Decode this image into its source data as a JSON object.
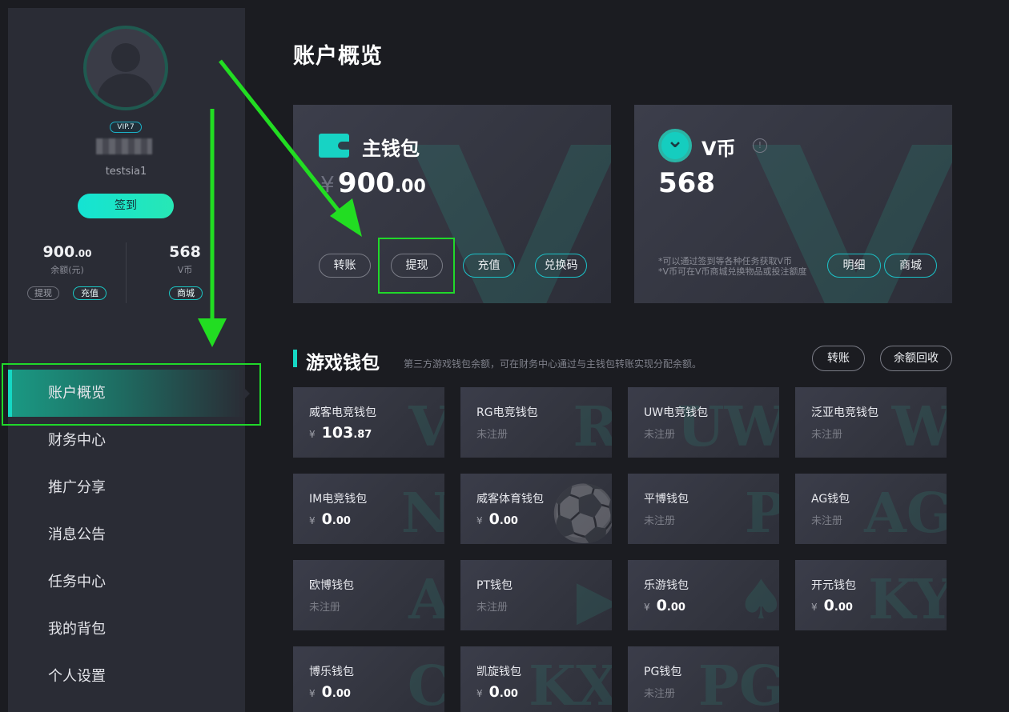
{
  "sidebar": {
    "vip_badge": "VIP.7",
    "username": "testsia1",
    "signin_label": "签到",
    "balance": {
      "int": "900",
      "dec": ".00",
      "label": "余额(元)"
    },
    "vcoin": {
      "value": "568",
      "label": "V币"
    },
    "withdraw_pill": "提现",
    "recharge_pill": "充值",
    "shop_pill": "商城",
    "nav": [
      "账户概览",
      "财务中心",
      "推广分享",
      "消息公告",
      "任务中心",
      "我的背包",
      "个人设置"
    ]
  },
  "main": {
    "title": "账户概览",
    "main_wallet": {
      "title": "主钱包",
      "currency": "¥",
      "amount_int": "900",
      "amount_dec": ".00",
      "buttons": [
        "转账",
        "提现",
        "充值",
        "兑换码"
      ]
    },
    "vcoin_card": {
      "title": "V币",
      "info": "!",
      "amount": "568",
      "note_1": "*可以通过签到等各种任务获取V币",
      "note_2": "*V币可在V币商城兑换物品或投注额度",
      "buttons": [
        "明细",
        "商城"
      ]
    },
    "game_section": {
      "title": "游戏钱包",
      "subtitle": "第三方游戏钱包余额，可在财务中心通过与主钱包转账实现分配余额。",
      "transfer_label": "转账",
      "recover_label": "余额回收"
    },
    "unregistered_label": "未注册",
    "currency": "¥",
    "games": [
      {
        "name": "威客电竞钱包",
        "int": "103",
        "dec": ".87",
        "deco": "V"
      },
      {
        "name": "RG电竞钱包",
        "registered": false,
        "deco": "R"
      },
      {
        "name": "UW电竞钱包",
        "registered": false,
        "deco": "UW"
      },
      {
        "name": "泛亚电竞钱包",
        "registered": false,
        "deco": "W"
      },
      {
        "name": "IM电竞钱包",
        "int": "0",
        "dec": ".00",
        "deco": "N"
      },
      {
        "name": "威客体育钱包",
        "int": "0",
        "dec": ".00",
        "deco": "⚽"
      },
      {
        "name": "平博钱包",
        "registered": false,
        "deco": "P"
      },
      {
        "name": "AG钱包",
        "registered": false,
        "deco": "AG"
      },
      {
        "name": "欧博钱包",
        "registered": false,
        "deco": "A"
      },
      {
        "name": "PT钱包",
        "registered": false,
        "deco": "▶"
      },
      {
        "name": "乐游钱包",
        "int": "0",
        "dec": ".00",
        "deco": "♠"
      },
      {
        "name": "开元钱包",
        "int": "0",
        "dec": ".00",
        "deco": "KY"
      },
      {
        "name": "博乐钱包",
        "int": "0",
        "dec": ".00",
        "deco": "C"
      },
      {
        "name": "凯旋钱包",
        "int": "0",
        "dec": ".00",
        "deco": "KX"
      },
      {
        "name": "PG钱包",
        "registered": false,
        "deco": "PG"
      }
    ]
  },
  "colors": {
    "accent": "#15d8c4",
    "annotation": "#20d82a"
  }
}
